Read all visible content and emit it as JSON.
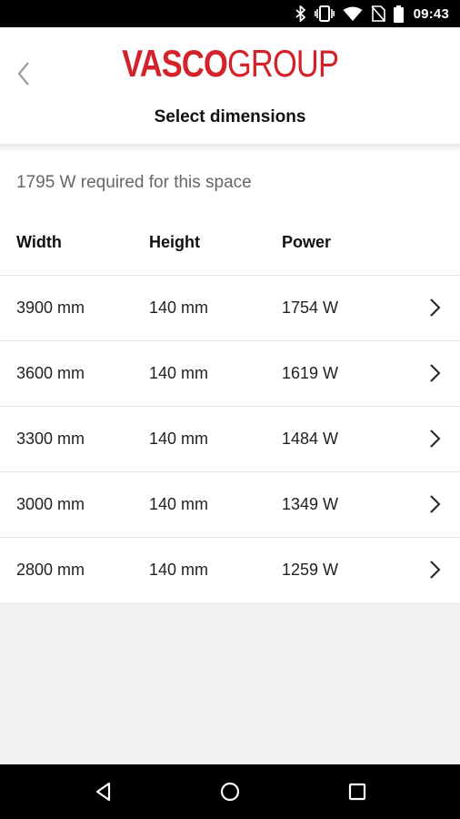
{
  "status_bar": {
    "time": "09:43",
    "icons": [
      "bluetooth-icon",
      "vibrate-icon",
      "wifi-icon",
      "no-sim-icon",
      "battery-icon"
    ]
  },
  "header": {
    "back_icon": "chevron-left-icon",
    "logo": {
      "part1": "VASCO",
      "part2": "GROUP",
      "color": "#d2232a"
    },
    "title": "Select dimensions"
  },
  "main": {
    "requirement": "1795 W required for this space",
    "columns": {
      "width": "Width",
      "height": "Height",
      "power": "Power"
    },
    "rows": [
      {
        "width": "3900 mm",
        "height": "140 mm",
        "power": "1754 W"
      },
      {
        "width": "3600 mm",
        "height": "140 mm",
        "power": "1619 W"
      },
      {
        "width": "3300 mm",
        "height": "140 mm",
        "power": "1484 W"
      },
      {
        "width": "3000 mm",
        "height": "140 mm",
        "power": "1349 W"
      },
      {
        "width": "2800 mm",
        "height": "140 mm",
        "power": "1259 W"
      }
    ]
  },
  "nav_bar": {
    "icons": [
      "back-triangle-icon",
      "home-circle-icon",
      "recents-square-icon"
    ]
  }
}
